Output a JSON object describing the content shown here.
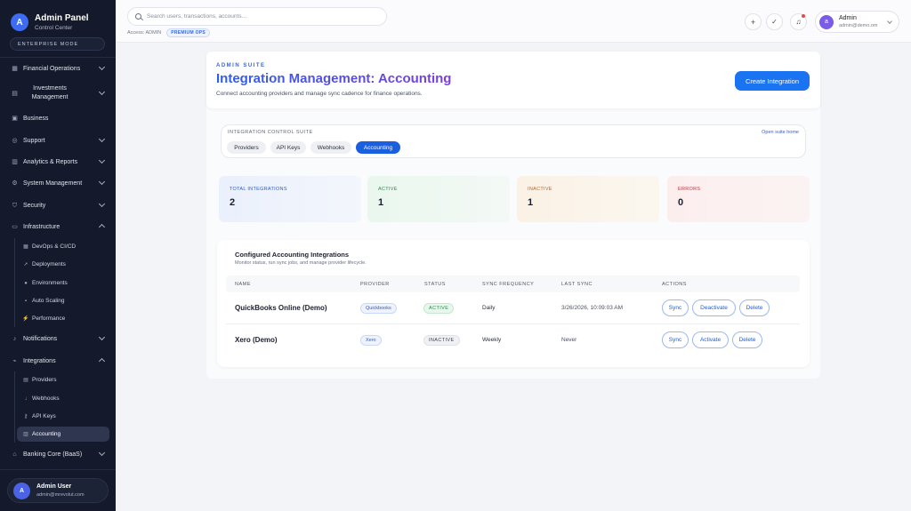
{
  "sidebar": {
    "brand_initial": "A",
    "brand_title": "Admin Panel",
    "brand_subtitle": "Control Center",
    "mode_label": "ENTERPRISE MODE",
    "items": [
      {
        "label": "Financial Operations",
        "icon": "bank-icon"
      },
      {
        "label": "Investments Management",
        "icon": "chart-icon"
      },
      {
        "label": "Business",
        "icon": "briefcase-icon"
      },
      {
        "label": "Support",
        "icon": "headset-icon"
      },
      {
        "label": "Analytics & Reports",
        "icon": "bar-chart-icon"
      },
      {
        "label": "System Management",
        "icon": "gear-icon"
      },
      {
        "label": "Security",
        "icon": "shield-icon"
      },
      {
        "label": "Infrastructure",
        "icon": "server-icon"
      },
      {
        "label": "Notifications",
        "icon": "bell-icon"
      },
      {
        "label": "Integrations",
        "icon": "plug-icon"
      },
      {
        "label": "Banking Core (BaaS)",
        "icon": "bank-building-icon"
      }
    ],
    "infrastructure_sub": [
      {
        "label": "DevOps & CI/CD"
      },
      {
        "label": "Deployments"
      },
      {
        "label": "Environments"
      },
      {
        "label": "Auto Scaling"
      },
      {
        "label": "Performance"
      }
    ],
    "integrations_sub": [
      {
        "label": "Providers"
      },
      {
        "label": "Webhooks"
      },
      {
        "label": "API Keys"
      },
      {
        "label": "Accounting"
      }
    ],
    "user": {
      "initial": "A",
      "name": "Admin User",
      "email": "admin@mrevolut.com"
    }
  },
  "topbar": {
    "search_placeholder": "Search users, transactions, accounts...",
    "access_label": "Access: ADMIN",
    "access_badge": "PREMIUM OPS",
    "profile": {
      "initial": "a",
      "name": "Admin",
      "email": "admin@demo.om"
    }
  },
  "header": {
    "eyebrow": "ADMIN SUITE",
    "title": "Integration Management: Accounting",
    "description": "Connect accounting providers and manage sync cadence for finance operations.",
    "create_button": "Create Integration"
  },
  "suite": {
    "label": "INTEGRATION CONTROL SUITE",
    "link": "Open suite home",
    "tabs": [
      "Providers",
      "API Keys",
      "Webhooks",
      "Accounting"
    ],
    "active_tab": "Accounting"
  },
  "stats": {
    "total": {
      "label": "TOTAL INTEGRATIONS",
      "value": "2"
    },
    "active": {
      "label": "ACTIVE",
      "value": "1"
    },
    "inactive": {
      "label": "INACTIVE",
      "value": "1"
    },
    "errors": {
      "label": "ERRORS",
      "value": "0"
    }
  },
  "table": {
    "title": "Configured Accounting Integrations",
    "subtitle": "Monitor status, run sync jobs, and manage provider lifecycle.",
    "columns": [
      "NAME",
      "PROVIDER",
      "STATUS",
      "SYNC FREQUENCY",
      "LAST SYNC",
      "ACTIONS"
    ],
    "rows": [
      {
        "name": "QuickBooks Online (Demo)",
        "provider": "Quickbooks",
        "status": "ACTIVE",
        "frequency": "Daily",
        "last_sync": "3/26/2026, 10:09:03 AM",
        "actions": [
          "Sync",
          "Deactivate",
          "Delete"
        ]
      },
      {
        "name": "Xero (Demo)",
        "provider": "Xero",
        "status": "INACTIVE",
        "frequency": "Weekly",
        "last_sync": "Never",
        "actions": [
          "Sync",
          "Activate",
          "Delete"
        ]
      }
    ]
  },
  "colors": {
    "accent": "#1a73f0",
    "sidebar_bg": "#141a2b",
    "active": "#2b8a4a",
    "error": "#c0333a"
  }
}
